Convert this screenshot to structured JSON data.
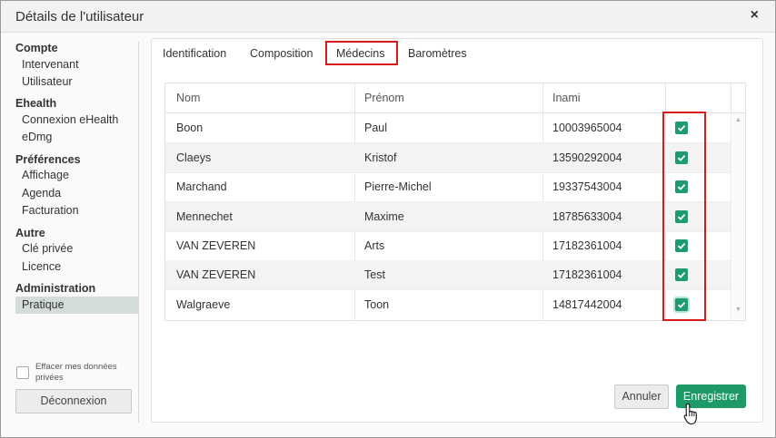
{
  "dialog": {
    "title": "Détails de l'utilisateur",
    "close": "×"
  },
  "sidebar": {
    "groups": [
      {
        "header": "Compte",
        "items": [
          "Intervenant",
          "Utilisateur"
        ]
      },
      {
        "header": "Ehealth",
        "items": [
          "Connexion eHealth",
          "eDmg"
        ]
      },
      {
        "header": "Préférences",
        "items": [
          "Affichage",
          "Agenda",
          "Facturation"
        ]
      },
      {
        "header": "Autre",
        "items": [
          "Clé privée",
          "Licence"
        ]
      },
      {
        "header": "Administration",
        "items": [
          "Pratique"
        ]
      }
    ],
    "active_item": "Pratique",
    "clear_data_label": "Effacer mes données privées",
    "clear_data_checked": false,
    "logout_label": "Déconnexion"
  },
  "tabs": [
    {
      "label": "Identification",
      "active": false
    },
    {
      "label": "Composition",
      "active": false
    },
    {
      "label": "Médecins",
      "active": true
    },
    {
      "label": "Baromètres",
      "active": false
    }
  ],
  "table": {
    "columns": [
      "Nom",
      "Prénom",
      "Inami",
      ""
    ],
    "rows": [
      {
        "nom": "Boon",
        "prenom": "Paul",
        "inami": "10003965004",
        "checked": true
      },
      {
        "nom": "Claeys",
        "prenom": "Kristof",
        "inami": "13590292004",
        "checked": true
      },
      {
        "nom": "Marchand",
        "prenom": "Pierre-Michel",
        "inami": "19337543004",
        "checked": true
      },
      {
        "nom": "Mennechet",
        "prenom": "Maxime",
        "inami": "18785633004",
        "checked": true
      },
      {
        "nom": "VAN ZEVEREN",
        "prenom": "Arts",
        "inami": "17182361004",
        "checked": true
      },
      {
        "nom": "VAN ZEVEREN",
        "prenom": "Test",
        "inami": "17182361004",
        "checked": true
      },
      {
        "nom": "Walgraeve",
        "prenom": "Toon",
        "inami": "14817442004",
        "checked": true
      }
    ]
  },
  "buttons": {
    "cancel": "Annuler",
    "save": "Enregistrer"
  },
  "colors": {
    "accent": "#1e9a66",
    "highlight": "#d91a1a",
    "active_bg": "#d4dcd7"
  }
}
